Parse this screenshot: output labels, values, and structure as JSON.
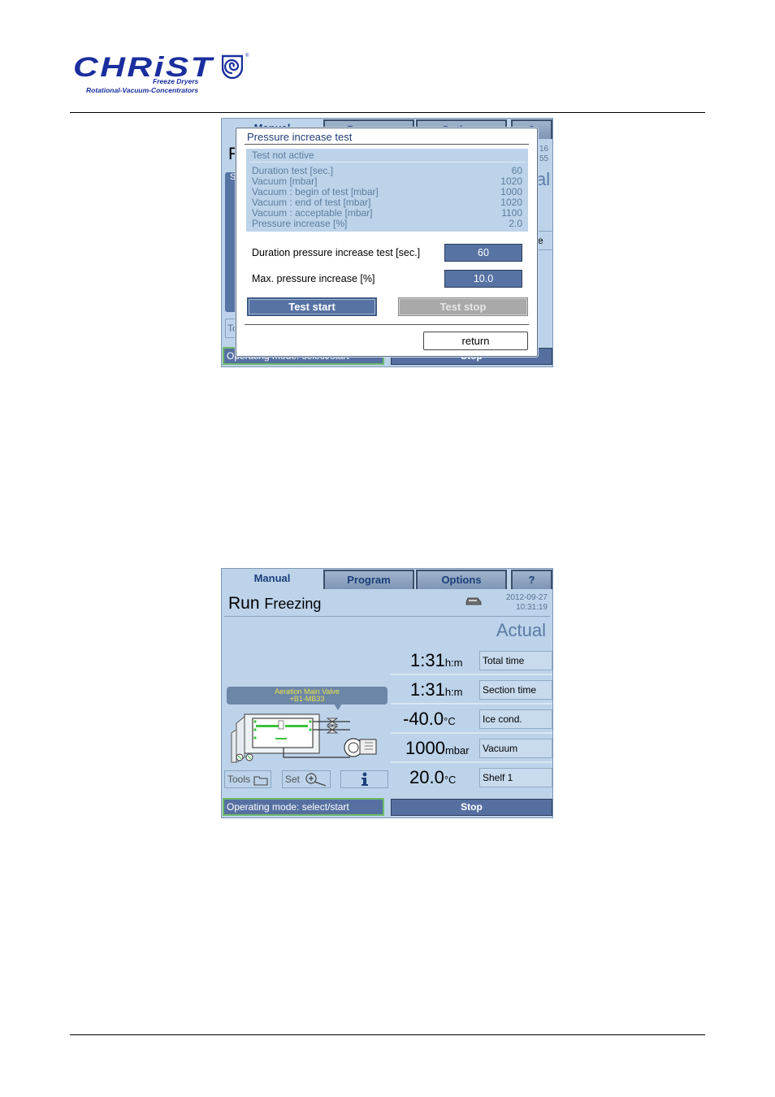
{
  "logo": {
    "word": "CHRiST",
    "line1": "Freeze Dryers",
    "line2": "Rotational-Vacuum-Concentrators",
    "registered": "®"
  },
  "tabs": [
    "Manual",
    "Program",
    "Options",
    "?"
  ],
  "screen1": {
    "bg_title_char": "R",
    "bg_date_frag1": "16",
    "bg_date_frag2": "55",
    "bg_actual_frag": "al",
    "bg_side_s": "S",
    "bg_side_to": "To",
    "bg_side_e": "e",
    "status_left": "Operating mode: select/start",
    "status_right": "Stop",
    "dialog": {
      "title": "Pressure increase test",
      "status": "Test not active",
      "rows": [
        {
          "label": "Duration test [sec.]",
          "value": "60"
        },
        {
          "label": "Vacuum [mbar]",
          "value": "1020"
        },
        {
          "label": "Vacuum : begin of test [mbar]",
          "value": "1000"
        },
        {
          "label": "Vacuum : end of test [mbar]",
          "value": "1020"
        },
        {
          "label": "Vacuum : acceptable [mbar]",
          "value": "1100"
        },
        {
          "label": "Pressure increase [%]",
          "value": "2.0"
        }
      ],
      "duration_label": "Duration pressure increase test [sec.]",
      "duration_value": "60",
      "max_label": "Max. pressure increase [%]",
      "max_value": "10.0",
      "start_label": "Test start",
      "stop_label": "Test stop",
      "return_label": "return"
    }
  },
  "screen2": {
    "run": "Run",
    "mode": "Freezing",
    "date": "2012-09-27",
    "time": "10:31:19",
    "actual": "Actual",
    "readings": [
      {
        "value": "1:31",
        "unit": "h:m",
        "label": "Total time"
      },
      {
        "value": "1:31",
        "unit": "h:m",
        "label": "Section time"
      },
      {
        "value": "-40.0",
        "unit": "°C",
        "label": "Ice cond."
      },
      {
        "value": "1000",
        "unit": "mbar",
        "label": "Vacuum"
      },
      {
        "value": "20.0",
        "unit": "°C",
        "label": "Shelf 1"
      }
    ],
    "tooltip_line1": "Aeration Main Valve",
    "tooltip_line2": "+B1-MB33",
    "tools_label": "Tools",
    "set_label": "Set",
    "status_left": "Operating mode: select/start",
    "status_right": "Stop"
  }
}
